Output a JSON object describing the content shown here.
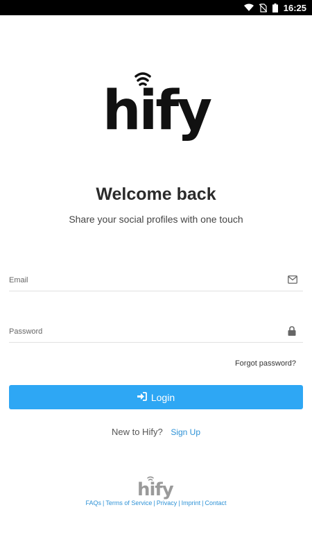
{
  "status_bar": {
    "time": "16:25",
    "icons": [
      "wifi-icon",
      "no-sim-icon",
      "battery-icon"
    ]
  },
  "logo": {
    "text": "hify"
  },
  "welcome": {
    "title": "Welcome back",
    "subtitle": "Share your social profiles with one touch"
  },
  "form": {
    "email_placeholder": "Email",
    "password_placeholder": "Password",
    "email_icon": "envelope-icon",
    "password_icon": "lock-icon",
    "forgot_label": "Forgot password?",
    "login_label": "Login",
    "login_icon": "sign-in-icon"
  },
  "signup": {
    "prompt": "New to Hify?",
    "link_label": "Sign Up"
  },
  "footer": {
    "logo_text": "hify",
    "links": [
      "FAQs",
      "Terms of Service",
      "Privacy",
      "Imprint",
      "Contact"
    ]
  },
  "colors": {
    "accent": "#2ea7f4",
    "link": "#2e92d6",
    "status_bar": "#000000"
  }
}
